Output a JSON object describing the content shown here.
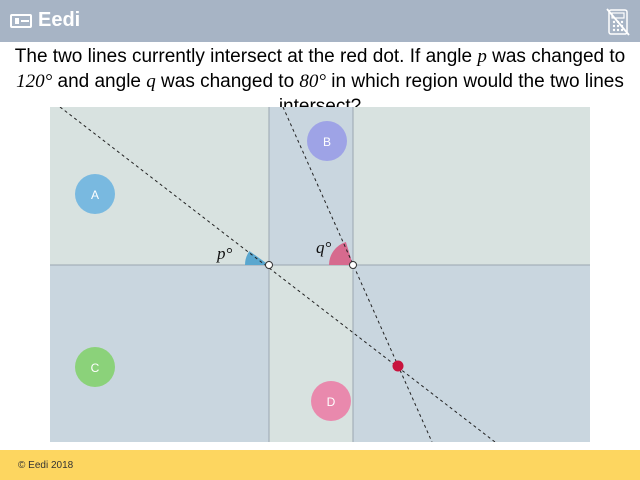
{
  "header": {
    "logo_text": "Eedi",
    "icons": [
      "logo-mark-icon",
      "calculator-crossed-icon"
    ],
    "background": "#a7b4c5"
  },
  "question": {
    "part1": "The two lines currently intersect at the red dot. If angle ",
    "var_p": "p",
    "part2": " was changed to ",
    "angle_p_value": "120°",
    "part3": " and angle ",
    "var_q": "q",
    "part4": " was changed to ",
    "angle_q_value": "80°",
    "part5": " in which region would the two lines intersect?"
  },
  "diagram": {
    "regions": [
      {
        "label": "A",
        "color": "#79b9e0"
      },
      {
        "label": "B",
        "color": "#9ea3e6"
      },
      {
        "label": "C",
        "color": "#8bd27a"
      },
      {
        "label": "D",
        "color": "#e989ad"
      }
    ],
    "angle_labels": {
      "p": "p°",
      "q": "q°"
    },
    "colors": {
      "panel_light": "#d8e2e0",
      "panel_blue": "#c9d6df",
      "angle_p_fill": "#5aa7cf",
      "angle_q_fill": "#d66a8e",
      "red_dot": "#c8133d"
    }
  },
  "footer": {
    "text": "© Eedi 2018",
    "background": "#fdd660"
  }
}
